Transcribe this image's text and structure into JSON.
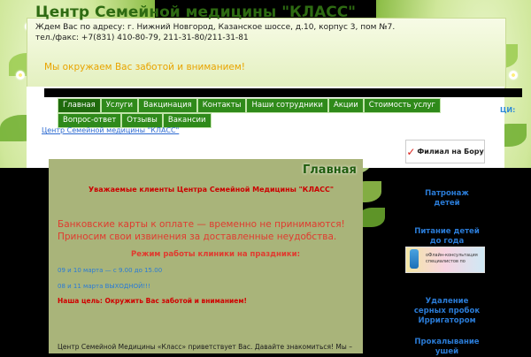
{
  "header": {
    "title": "Центр Семейной медицины \"КЛАСС\"",
    "address": "Ждем Вас по адресу: г. Нижний Новгород, Казанское шоссе, д.10, корпус 3, пом №7.",
    "phone": "тел./факс: +7(831) 410-80-79, 211-31-80/211-31-81",
    "slogan": "Мы окружаем Вас заботой и вниманием!"
  },
  "nav": {
    "items": [
      {
        "label": "Главная"
      },
      {
        "label": "Услуги"
      },
      {
        "label": "Вакцинация"
      },
      {
        "label": "Контакты"
      },
      {
        "label": "Наши сотрудники"
      },
      {
        "label": "Акции"
      },
      {
        "label": "Стоимость услуг"
      },
      {
        "label": "Вопрос-ответ"
      },
      {
        "label": "Отзывы"
      },
      {
        "label": "Вакансии"
      }
    ],
    "stray_text": "ЦИ:"
  },
  "breadcrumb": "Центр Семейной медицины \"КЛАСС\"",
  "main": {
    "title": "Главная",
    "notice_heading": "Уважаемые клиенты Центра Семейной Медицины \"КЛАСС\"",
    "card_notice_1": "Банковские карты к оплате — временно не принимаются!",
    "card_notice_2": "Приносим свои извинения за доставленные неудобства.",
    "holiday_heading": "Режим работы клиники на праздники:",
    "schedule_1": "09 и 10 марта — с 9.00 до 15.00",
    "schedule_2": "08 и 11 марта ВЫХОДНОЙ!!!",
    "goal": "Наша цель: Окружить Вас заботой и вниманием!",
    "welcome": "Центр Семейной Медицины «Класс» приветствует Вас. Давайте знакомиться! Мы –"
  },
  "sidebar": {
    "filial_banner": "Филиал на Бору",
    "links": [
      {
        "line1": "Патронаж",
        "line2": "детей"
      },
      {
        "line1": "Питание детей",
        "line2": "до года"
      },
      {
        "line1": "Удаление",
        "line2": "серных пробок",
        "line3": "Ирригатором"
      },
      {
        "line1": "Прокалывание",
        "line2": "ушей"
      }
    ],
    "banner_line1": "оФлайн-консультация",
    "banner_line2": "специалистов по"
  },
  "colors": {
    "nav_green": "#2f8a1a",
    "title_green": "#2e6b12",
    "slogan_orange": "#e9a400",
    "alert_red": "#e03b2f",
    "link_blue": "#2a7bd6",
    "main_panel": "#a9b47a"
  }
}
